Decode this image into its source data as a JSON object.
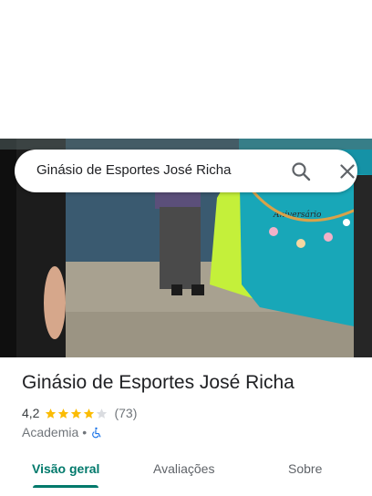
{
  "search": {
    "query": "Ginásio de Esportes José Richa",
    "search_icon": "search-icon",
    "close_icon": "close-icon"
  },
  "place": {
    "title": "Ginásio de Esportes José Richa",
    "rating": "4,2",
    "rating_value": 4.2,
    "review_count": "(73)",
    "category": "Academia",
    "separator": "•",
    "accessibility_icon": "wheelchair-icon"
  },
  "tabs": [
    {
      "label": "Visão geral",
      "active": true
    },
    {
      "label": "Avaliações",
      "active": false
    },
    {
      "label": "Sobre",
      "active": false
    }
  ],
  "photo": {
    "banner_text": "Aniversário"
  },
  "colors": {
    "accent": "#00796b",
    "star": "#fbbc04",
    "star_empty": "#dadce0",
    "accessibility": "#1a73e8"
  }
}
